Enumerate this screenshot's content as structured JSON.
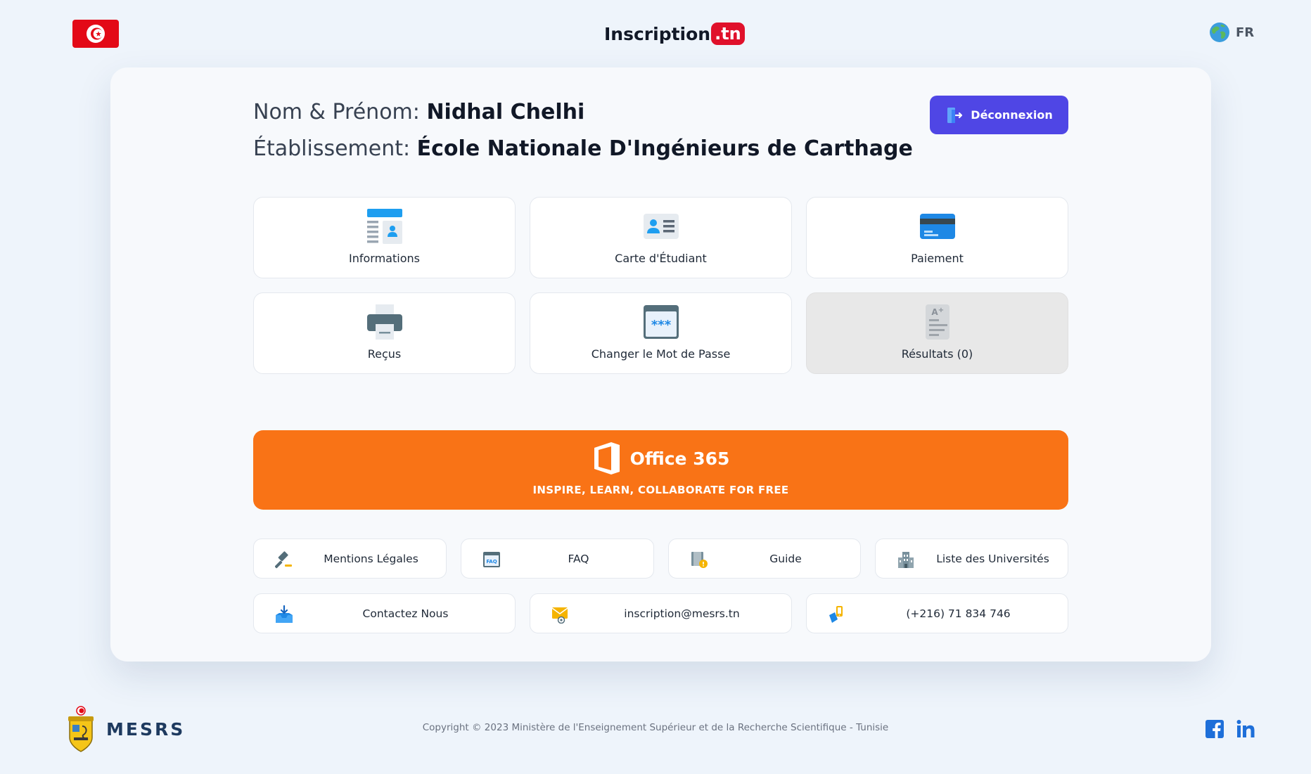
{
  "header": {
    "brand_main": "Inscription",
    "brand_suffix": ".tn",
    "language": "FR"
  },
  "profile": {
    "name_label": "Nom & Prénom:",
    "name_value": "Nidhal Chelhi",
    "school_label": "Établissement:",
    "school_value": "École Nationale D'Ingénieurs de Carthage",
    "logout_label": "Déconnexion"
  },
  "tiles": [
    {
      "label": "Informations",
      "icon": "id-document-icon"
    },
    {
      "label": "Carte d'Étudiant",
      "icon": "student-card-icon"
    },
    {
      "label": "Paiement",
      "icon": "credit-card-icon"
    },
    {
      "label": "Reçus",
      "icon": "printer-icon"
    },
    {
      "label": "Changer le Mot de Passe",
      "icon": "password-icon"
    },
    {
      "label": "Résultats (0)",
      "icon": "grade-report-icon",
      "disabled": true
    }
  ],
  "office": {
    "title": "Office 365",
    "subtitle": "INSPIRE, LEARN, COLLABORATE FOR FREE"
  },
  "links": [
    {
      "label": "Mentions Légales",
      "icon": "gavel-icon"
    },
    {
      "label": "FAQ",
      "icon": "faq-icon"
    },
    {
      "label": "Guide",
      "icon": "guide-book-icon"
    },
    {
      "label": "Liste des Universités",
      "icon": "university-building-icon"
    },
    {
      "label": "Contactez Nous",
      "icon": "inbox-download-icon"
    },
    {
      "label": "inscription@mesrs.tn",
      "icon": "email-icon"
    },
    {
      "label": "(+216) 71 834 746",
      "icon": "phone-icon"
    }
  ],
  "footer": {
    "org": "MESRS",
    "copyright": "Copyright © 2023 Ministère de l'Enseignement Supérieur et de la Recherche Scientifique - Tunisie"
  },
  "colors": {
    "accent": "#4f46e5",
    "office": "#f97316",
    "flag": "#e30a17",
    "icon_blue": "#1e88e5"
  }
}
